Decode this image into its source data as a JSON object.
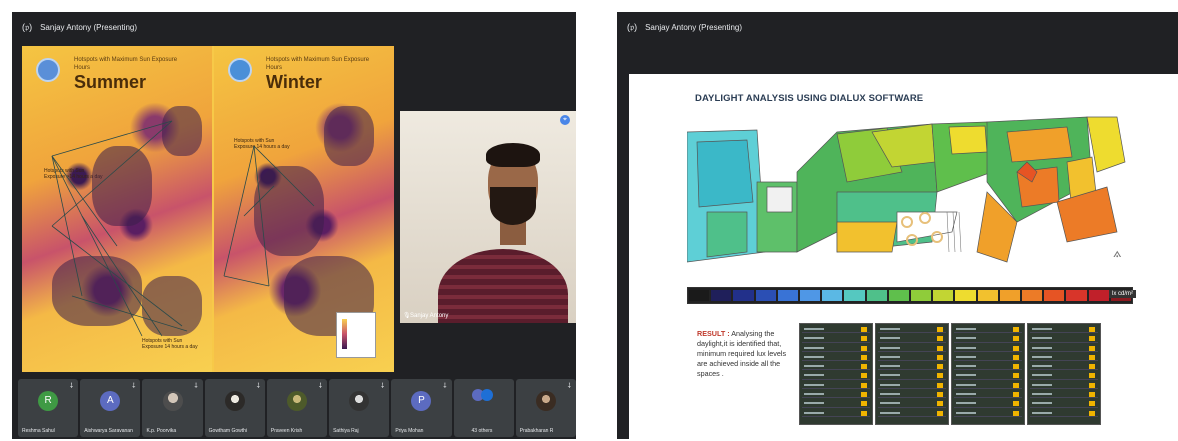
{
  "left_window": {
    "presenter_bar": "Sanjay Antony (Presenting)",
    "slide": {
      "summer_panel": {
        "heading": "Hotspots with Maximum Sun Exposure Hours",
        "season": "Summer",
        "note_top": "Hotspots with Sun Exposure >14 hours a day",
        "note_bottom": "Hotspots with Sun Exposure 14 hours a day"
      },
      "winter_panel": {
        "heading": "Hotspots with Maximum Sun Exposure Hours",
        "season": "Winter",
        "note_top": "Hotspots with Sun Exposure 14 hours a day"
      }
    },
    "video_tile": {
      "name": "Sanjay Antony",
      "pin_icon": "pin-icon"
    },
    "participants": [
      {
        "name": "Reshma Sahul",
        "initial": "R",
        "color": "#3f9a44"
      },
      {
        "name": "Aishwarya Saravanan",
        "initial": "A",
        "color": "#5c6bc0"
      },
      {
        "name": "K.p. Poorvika",
        "initial": "",
        "color": ""
      },
      {
        "name": "Gowtham Gowthi",
        "initial": "",
        "color": ""
      },
      {
        "name": "Praveen Krish",
        "initial": "",
        "color": ""
      },
      {
        "name": "Sathiya Raj",
        "initial": "",
        "color": ""
      },
      {
        "name": "Priya Mohan",
        "initial": "P",
        "color": "#5c6bc0"
      },
      {
        "name": "43 others",
        "initial": "",
        "color": ""
      },
      {
        "name": "Prabakharan R",
        "initial": "",
        "color": ""
      }
    ]
  },
  "right_window": {
    "presenter_bar": "Sanjay Antony (Presenting)",
    "slide": {
      "title": "DAYLIGHT ANALYSIS USING DIALUX SOFTWARE",
      "lux_label": "lx  cd/m²",
      "result_label": "RESULT :",
      "result_text": "Analysing the daylight,it is identified that, minimum required lux levels are achieved inside all the spaces .",
      "scale_colors": [
        "#1a1a1a",
        "#1f1f5a",
        "#22308a",
        "#2b4fb4",
        "#3973d6",
        "#4f97e6",
        "#5bb8e4",
        "#55c8c0",
        "#4fc08a",
        "#5fbf4c",
        "#8fcc3a",
        "#c2d533",
        "#eedc2f",
        "#f2c12e",
        "#f0a02a",
        "#ec7b27",
        "#e65424",
        "#d8352a",
        "#c0202a",
        "#8a1a20"
      ]
    }
  }
}
